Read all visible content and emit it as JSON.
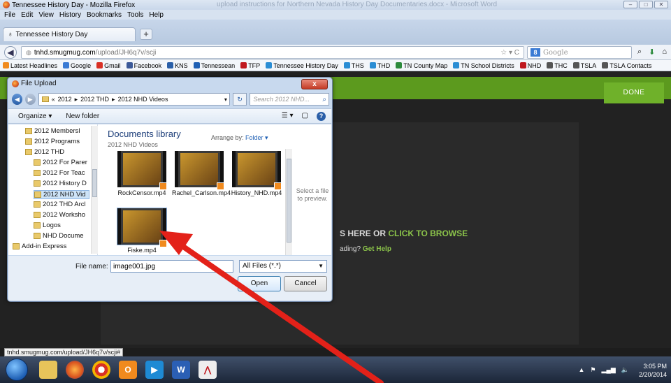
{
  "window": {
    "title": "Tennessee History Day - Mozilla Firefox",
    "background_title": "upload instructions for Northern Nevada History Day Documentaries.docx - Microsoft Word"
  },
  "menu": [
    "File",
    "Edit",
    "View",
    "History",
    "Bookmarks",
    "Tools",
    "Help"
  ],
  "tab": {
    "label": "Tennessee History Day",
    "new_tab": "+"
  },
  "url": {
    "host": "tnhd.smugmug.com",
    "path": "/upload/JH6q7v/scji"
  },
  "search": {
    "engine": "8",
    "placeholder": "Google"
  },
  "bookmarks": [
    {
      "label": "Latest Headlines",
      "color": "#f08a1e"
    },
    {
      "label": "Google",
      "color": "#3b7bd4"
    },
    {
      "label": "Gmail",
      "color": "#d93025"
    },
    {
      "label": "Facebook",
      "color": "#3b5998"
    },
    {
      "label": "KNS",
      "color": "#2a5fa8"
    },
    {
      "label": "Tennessean",
      "color": "#1e5fb4"
    },
    {
      "label": "TFP",
      "color": "#c0181e"
    },
    {
      "label": "Tennessee History Day",
      "color": "#2a8dd4"
    },
    {
      "label": "THS",
      "color": "#2a8dd4"
    },
    {
      "label": "THD",
      "color": "#2a8dd4"
    },
    {
      "label": "TN County Map",
      "color": "#2c8a3c"
    },
    {
      "label": "TN School Districts",
      "color": "#2a8dd4"
    },
    {
      "label": "NHD",
      "color": "#c0181e"
    },
    {
      "label": "THC",
      "color": "#555555"
    },
    {
      "label": "TSLA",
      "color": "#555555"
    },
    {
      "label": "TSLA Contacts",
      "color": "#555555"
    }
  ],
  "page": {
    "done_label": "DONE",
    "drop_prefix": "S HERE OR ",
    "drop_link": "CLICK TO BROWSE",
    "help_prefix": "ading? ",
    "help_link": "Get Help"
  },
  "dialog": {
    "title": "File Upload",
    "close": "x",
    "path": [
      "«",
      "2012",
      "▸",
      "2012 THD",
      "▸",
      "2012 NHD Videos"
    ],
    "search_placeholder": "Search 2012 NHD...",
    "organize": "Organize ▾",
    "new_folder": "New folder",
    "help": "?",
    "tree": [
      {
        "label": "2012 Membersl",
        "selected": false
      },
      {
        "label": "2012 Programs",
        "selected": false
      },
      {
        "label": "2012 THD",
        "selected": false
      },
      {
        "label": "2012 For Parer",
        "selected": false
      },
      {
        "label": "2012 For Teac",
        "selected": false
      },
      {
        "label": "2012 History D",
        "selected": false
      },
      {
        "label": "2012 NHD Vid",
        "selected": true
      },
      {
        "label": "2012 THD Arcl",
        "selected": false
      },
      {
        "label": "2012 Worksho",
        "selected": false
      },
      {
        "label": "Logos",
        "selected": false
      },
      {
        "label": "NHD Docume",
        "selected": false
      },
      {
        "label": "Add-in Express",
        "selected": false
      }
    ],
    "library_title": "Documents library",
    "library_sub": "2012 NHD Videos",
    "arrange_label": "Arrange by:",
    "arrange_value": "Folder ▾",
    "files": [
      {
        "name": "RockCensor.mp4"
      },
      {
        "name": "Rachel_Carlson.mp4"
      },
      {
        "name": "History_NHD.mp4"
      },
      {
        "name": "Fiske.mp4"
      }
    ],
    "preview_text": "Select a file to preview.",
    "file_name_label": "File name:",
    "file_name_value": "image001.jpg",
    "filter_value": "All Files (*.*)",
    "open_label": "Open",
    "cancel_label": "Cancel"
  },
  "status": "tnhd.smugmug.com/upload/JH6q7v/scji#",
  "clock": {
    "time": "3:05 PM",
    "date": "2/20/2014"
  },
  "colors": {
    "accent_green": "#6fb12a",
    "arrow_red": "#e32119"
  }
}
